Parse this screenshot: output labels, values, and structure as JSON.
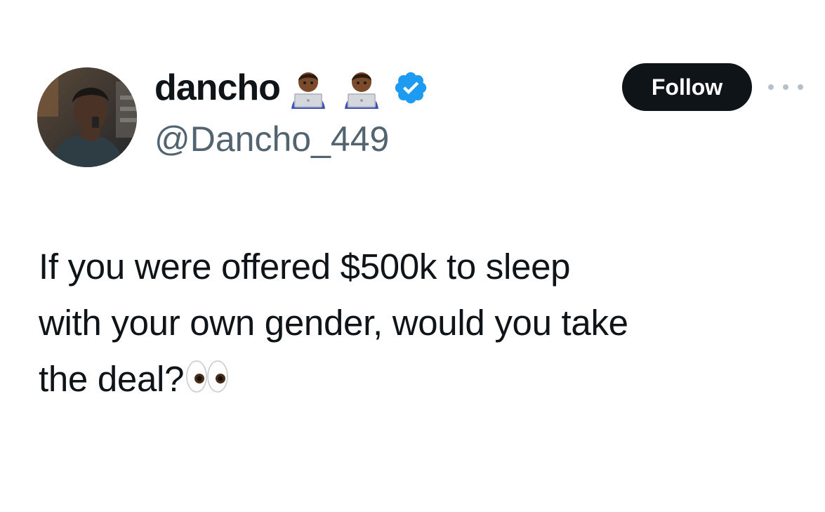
{
  "tweet": {
    "author": {
      "display_name": "dancho",
      "handle": "@Dancho_449",
      "name_emojis": [
        "technologist-dark-skin-icon",
        "technologist-dark-skin-icon"
      ],
      "verified": true,
      "verified_color": "#1d9bf0"
    },
    "follow_label": "Follow",
    "more_icon": "more-horizontal-icon",
    "text_lines": [
      "If you were offered $500k to sleep",
      "with your own gender, would you take",
      "the deal?"
    ],
    "text_trailing_emoji": "eyes-icon"
  },
  "colors": {
    "text": "#0f1419",
    "handle": "#536471",
    "follow_bg": "#0f1419",
    "follow_text": "#ffffff",
    "more_dots": "#b9c1c8"
  }
}
